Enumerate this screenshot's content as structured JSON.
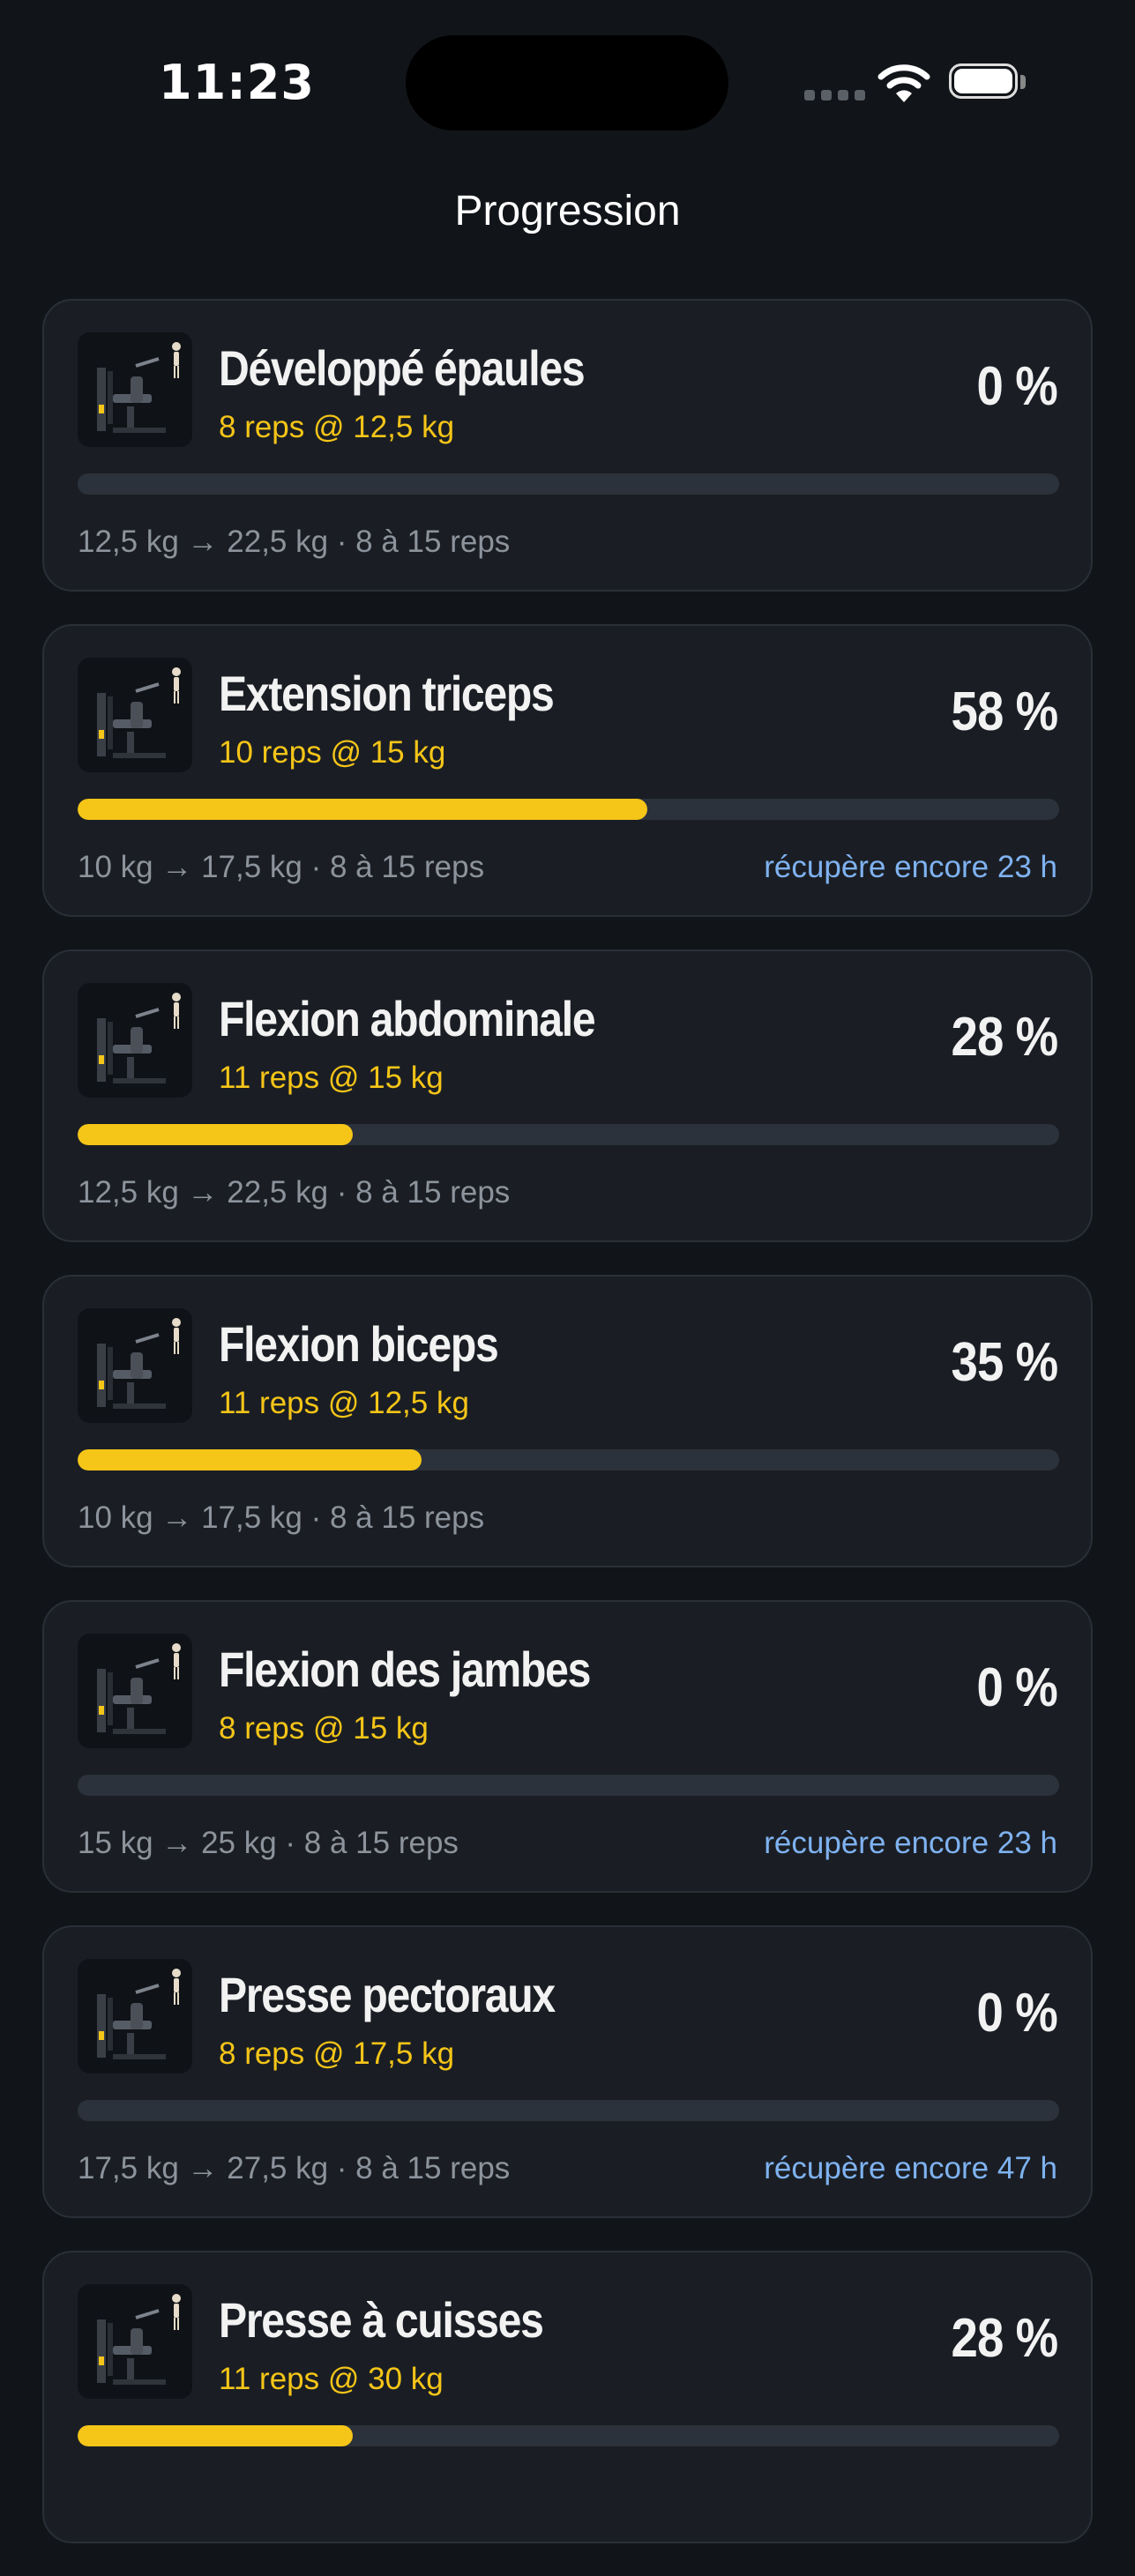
{
  "status_bar": {
    "time": "11:23",
    "signal_icon": "cellular-signal-icon",
    "wifi_icon": "wifi-icon",
    "battery_icon": "battery-full-icon"
  },
  "header": {
    "title": "Progression"
  },
  "colors": {
    "background": "#111418",
    "card": "#1a1e24",
    "accent": "#f5c518",
    "recover": "#7fb2f0",
    "muted": "#8d939c",
    "track": "#2c323b"
  },
  "exercises": [
    {
      "name": "Développé épaules",
      "sets": "8 reps @ 12,5 kg",
      "percent_label": "0 %",
      "progress": 0,
      "range": "12,5 kg → 22,5 kg · 8 à 15 reps",
      "recovery": "",
      "icon": "machine-shoulder-press-icon"
    },
    {
      "name": "Extension triceps",
      "sets": "10 reps @ 15 kg",
      "percent_label": "58 %",
      "progress": 0.58,
      "range": "10 kg → 17,5 kg · 8 à 15 reps",
      "recovery": "récupère encore 23 h",
      "icon": "machine-triceps-extension-icon"
    },
    {
      "name": "Flexion abdominale",
      "sets": "11 reps @ 15 kg",
      "percent_label": "28 %",
      "progress": 0.28,
      "range": "12,5 kg → 22,5 kg · 8 à 15 reps",
      "recovery": "",
      "icon": "machine-abdominal-crunch-icon"
    },
    {
      "name": "Flexion biceps",
      "sets": "11 reps @ 12,5 kg",
      "percent_label": "35 %",
      "progress": 0.35,
      "range": "10 kg → 17,5 kg · 8 à 15 reps",
      "recovery": "",
      "icon": "machine-biceps-curl-icon"
    },
    {
      "name": "Flexion des jambes",
      "sets": "8 reps @ 15 kg",
      "percent_label": "0 %",
      "progress": 0,
      "range": "15 kg → 25 kg · 8 à 15 reps",
      "recovery": "récupère encore 23 h",
      "icon": "machine-leg-curl-icon"
    },
    {
      "name": "Presse pectoraux",
      "sets": "8 reps @ 17,5 kg",
      "percent_label": "0 %",
      "progress": 0,
      "range": "17,5 kg → 27,5 kg · 8 à 15 reps",
      "recovery": "récupère encore 47 h",
      "icon": "machine-chest-press-icon"
    },
    {
      "name": "Presse à cuisses",
      "sets": "11 reps @ 30 kg",
      "percent_label": "28 %",
      "progress": 0.28,
      "range": "",
      "recovery": "",
      "icon": "machine-leg-press-icon"
    }
  ]
}
